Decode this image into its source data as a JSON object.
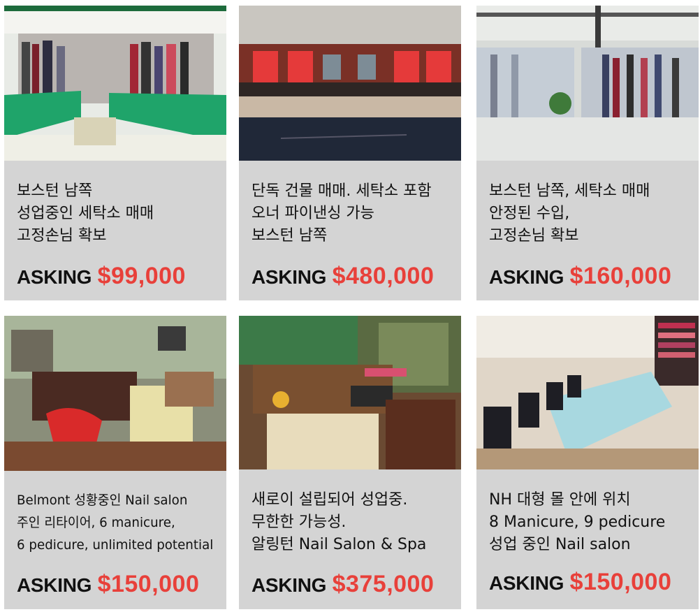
{
  "asking_label": "ASKING",
  "listings": [
    {
      "image_icon": "dry-cleaner-interior-image",
      "lines": [
        "보스턴 남쪽",
        "성업중인 세탁소 매매",
        "고정손님 확보"
      ],
      "price": "$99,000"
    },
    {
      "image_icon": "storefront-building-image",
      "lines": [
        "단독 건물 매매. 세탁소 포함",
        "오너 파이낸싱 가능",
        "보스턴 남쪽"
      ],
      "price": "$480,000"
    },
    {
      "image_icon": "laundry-clothes-rack-image",
      "lines": [
        "보스턴 남쪽, 세탁소 매매",
        "안정된 수입,",
        "고정손님 확보"
      ],
      "price": "$160,000"
    },
    {
      "image_icon": "nail-salon-belmont-image",
      "lines": [
        "Belmont 성황중인 Nail salon",
        "주인 리타이어, 6 manicure,",
        "6 pedicure, unlimited potential"
      ],
      "price": "$150,000"
    },
    {
      "image_icon": "nail-salon-arlington-image",
      "lines": [
        "새로이 설립되어 성업중.",
        "무한한 가능성.",
        "알링턴 Nail Salon & Spa"
      ],
      "price": "$375,000"
    },
    {
      "image_icon": "nail-salon-mall-image",
      "lines": [
        "NH 대형 몰 안에 위치",
        "8 Manicure, 9 pedicure",
        "성업 중인 Nail salon"
      ],
      "price": "$150,000"
    }
  ],
  "colors": {
    "card_background": "#d4d4d4",
    "price_red": "#e8403a",
    "text": "#111111"
  }
}
